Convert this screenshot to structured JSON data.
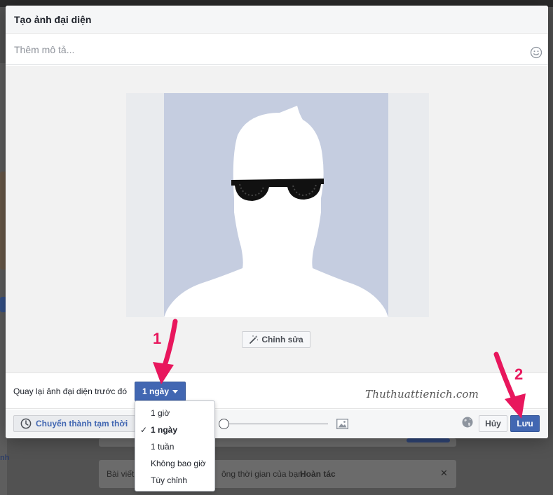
{
  "dialog": {
    "title": "Tạo ảnh đại diện",
    "description_placeholder": "Thêm mô tả...",
    "description_value": "",
    "edit_label": "Chỉnh sửa",
    "revert_label": "Quay lại ảnh đại diện trước đó",
    "duration_selected": "1 ngày",
    "watermark": "Thuthuattienich.com",
    "make_temporary_label": "Chuyển thành tạm thời",
    "cancel_label": "Hủy",
    "save_label": "Lưu"
  },
  "duration_menu": {
    "items": [
      {
        "label": "1 giờ",
        "selected": false
      },
      {
        "label": "1 ngày",
        "selected": true
      },
      {
        "label": "1 tuần",
        "selected": false
      },
      {
        "label": "Không bao giờ",
        "selected": false
      },
      {
        "label": "Tùy chỉnh",
        "selected": false
      }
    ],
    "check_glyph": "✓"
  },
  "background": {
    "notice_prefix": "Bài viết",
    "notice_suffix": "ông thời gian của bạn.",
    "undo_label": "Hoàn tác",
    "side_link": "nh",
    "close_glyph": "✕"
  },
  "annotations": {
    "step1": "1",
    "step2": "2",
    "color": "#e8175d"
  },
  "zoom": {
    "level": 0
  },
  "colors": {
    "primary": "#4267b2",
    "avatar_bg": "#c5cde0"
  }
}
